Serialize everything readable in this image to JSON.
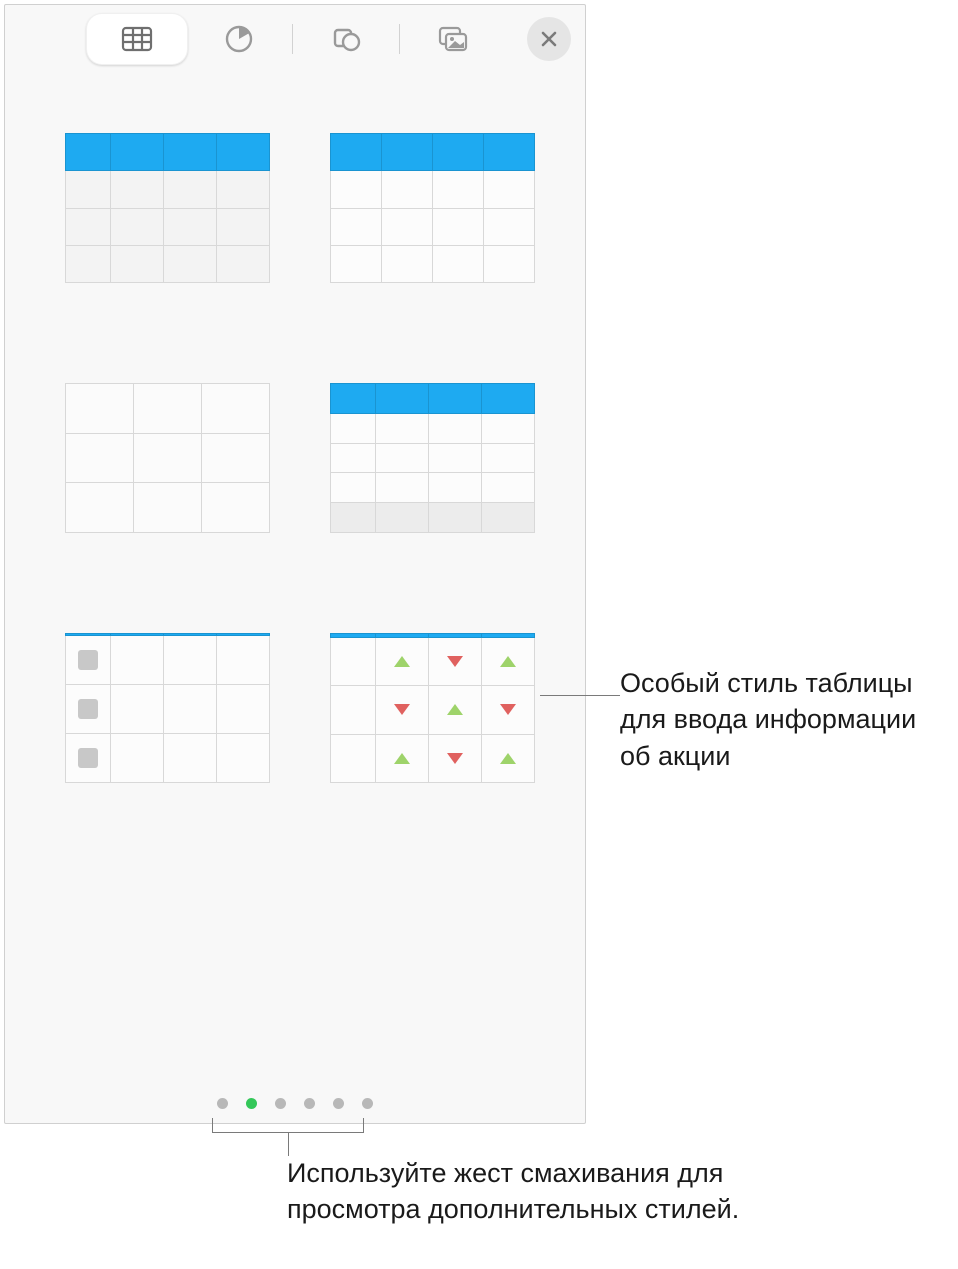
{
  "toolbar": {
    "tabs": [
      "table",
      "chart",
      "shape",
      "media"
    ],
    "active_index": 0
  },
  "pager": {
    "count": 6,
    "active_index": 1
  },
  "callouts": {
    "stock": "Особый стиль таблицы для ввода информации об акции",
    "swipe": "Используйте жест смахивания для просмотра дополнительных стилей."
  },
  "styles": [
    {
      "id": "blue-header-basic"
    },
    {
      "id": "blue-header-equal"
    },
    {
      "id": "plain-grid"
    },
    {
      "id": "blue-header-footer"
    },
    {
      "id": "checklist"
    },
    {
      "id": "stock-arrows"
    }
  ]
}
